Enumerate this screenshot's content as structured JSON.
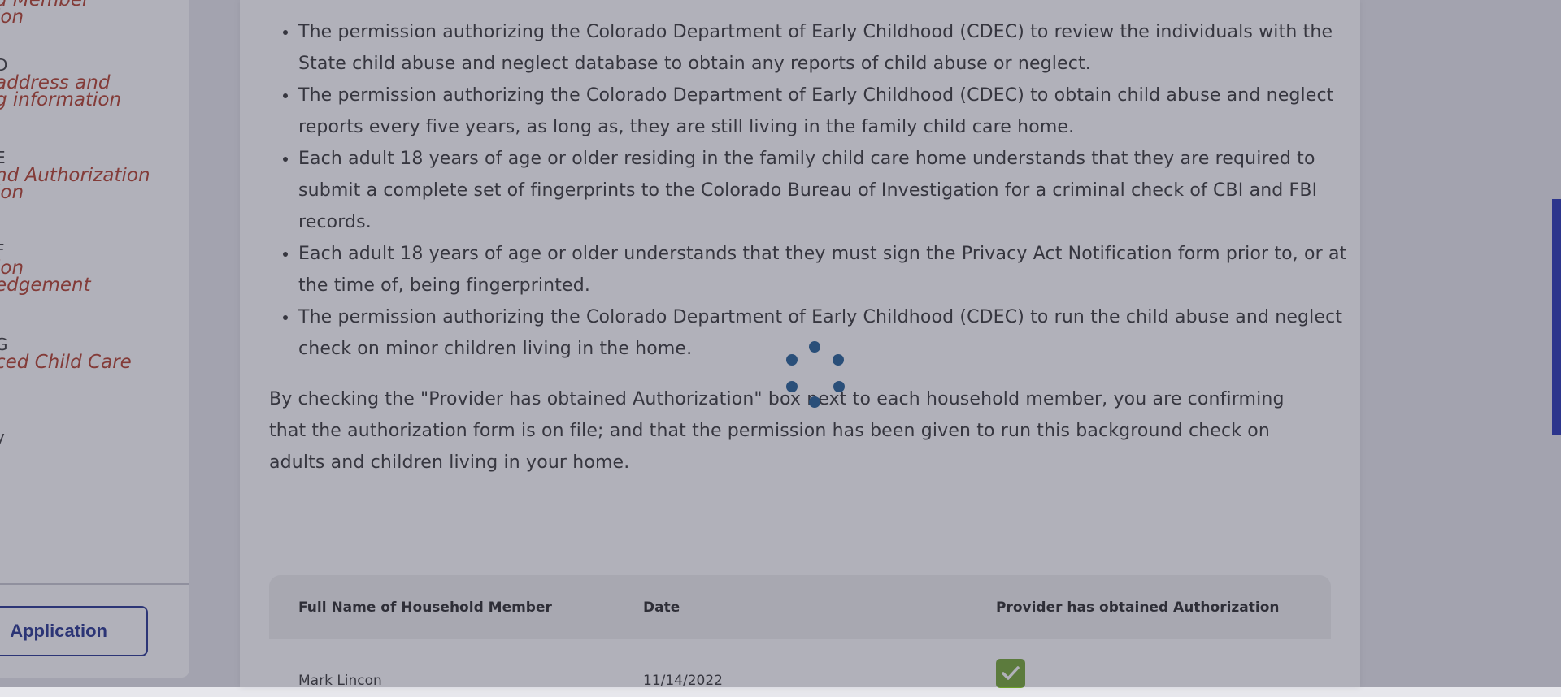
{
  "sidebar": {
    "steps": [
      {
        "letter": "",
        "title": "d Member\nion"
      },
      {
        "letter": "D",
        "title": "address and\ng information"
      },
      {
        "letter": "E",
        "title": "nd Authorization\nion"
      },
      {
        "letter": "F",
        "title": "ion\nedgement"
      },
      {
        "letter": "G",
        "title": "ced Child Care"
      },
      {
        "letter": "y",
        "title": ""
      }
    ],
    "submit_label": "Application"
  },
  "main": {
    "bullets": [
      "The permission authorizing the Colorado Department of Early Childhood (CDEC) to review the individuals with the State child abuse and neglect database to obtain any reports of child abuse or neglect.",
      "The permission authorizing the Colorado Department of Early Childhood (CDEC) to obtain child abuse and neglect reports every five years, as long as, they are still living in the family child care home.",
      "Each adult 18 years of age or older residing in the family child care home understands that they are required to submit a complete set of fingerprints to the Colorado Bureau of Investigation for a criminal check of CBI and FBI records.",
      "Each adult 18 years of age or older understands that they must sign the Privacy Act Notification form prior to, or at the time of, being fingerprinted.",
      "The permission authorizing the Colorado Department of Early Childhood (CDEC) to run the child abuse and neglect check on minor children living in the home."
    ],
    "paragraph": "By checking the \"Provider has obtained Authorization\" box next to each household member, you are confirming that the authorization form is on file; and that the permission has been given to run this background check on adults and children living in your home."
  },
  "table": {
    "headers": [
      "Full Name of Household Member",
      "Date",
      "Provider has obtained Authorization"
    ],
    "rows": [
      {
        "name": "Mark Lincon",
        "date": "11/14/2022",
        "authorized": true
      }
    ]
  },
  "colors": {
    "accent": "#1b2a8a",
    "step_title": "#b0341f",
    "checkbox": "#6da228",
    "spinner": "#2a4f79"
  },
  "icons": {
    "loading": "loading-spinner-icon",
    "checkbox": "checkmark-icon"
  }
}
